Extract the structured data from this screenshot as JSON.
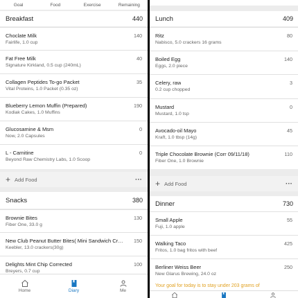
{
  "topbar": {
    "goal": "Goal",
    "food": "Food",
    "exercise": "Exercise",
    "remaining": "Remaining"
  },
  "left": {
    "breakfast": {
      "title": "Breakfast",
      "calories": "440",
      "items": [
        {
          "name": "Choclate Milk",
          "desc": "Fairlife, 1.0 cup",
          "kcal": "140"
        },
        {
          "name": "Fat Free Milk",
          "desc": "Signature Kirkland, 0.5 cup (240mL)",
          "kcal": "40"
        },
        {
          "name": "Collagen Peptides To-go Packet",
          "desc": "Vital Proteins, 1.0 Packet (0.35 oz)",
          "kcal": "35"
        },
        {
          "name": "Blueberry Lemon Muffin (Prepared)",
          "desc": "Kodiak Cakes, 1.0 Muffins",
          "kcal": "190"
        },
        {
          "name": "Glucosamine & Msm",
          "desc": "Now, 2.0 Capsules",
          "kcal": "0"
        },
        {
          "name": "L - Carnitine",
          "desc": "Beyond Raw Chemistry Labs, 1.0 Scoop",
          "kcal": "0"
        }
      ],
      "add_food": "Add Food"
    },
    "snacks": {
      "title": "Snacks",
      "calories": "380",
      "items": [
        {
          "name": "Brownie Bites",
          "desc": "Fiber One, 33.0 g",
          "kcal": "130"
        },
        {
          "name": "New Club Peanut Butter Bites( Mini Sandwich Crac...",
          "desc": "Keebler, 13.0 crackers(30g)",
          "kcal": "150"
        },
        {
          "name": "Delights Mint Chip Corrected",
          "desc": "Breyers, 0.7 cup",
          "kcal": "100"
        }
      ]
    },
    "nav": {
      "home": "Home",
      "diary": "Diary",
      "me": "Me"
    }
  },
  "right": {
    "lunch": {
      "title": "Lunch",
      "calories": "409",
      "items": [
        {
          "name": "Ritz",
          "desc": "Nabisco, 5.0 crackers  16 grams",
          "kcal": "80"
        },
        {
          "name": "Boiled Egg",
          "desc": "Eggs, 2.0 piece",
          "kcal": "140"
        },
        {
          "name": "Celery, raw",
          "desc": "0.2 cup chopped",
          "kcal": "3"
        },
        {
          "name": "Mustard",
          "desc": "Mustard, 1.0 tsp",
          "kcal": "0"
        },
        {
          "name": "Avocado-oil Mayo",
          "desc": "Kraft, 1.0 tbsp (14g)",
          "kcal": "45"
        },
        {
          "name": "Triple Chocolate Brownie (Corr 09/11/18)",
          "desc": "Fiber One, 1.0 Brownie",
          "kcal": "110"
        }
      ],
      "add_food": "Add Food"
    },
    "dinner": {
      "title": "Dinner",
      "calories": "730",
      "items": [
        {
          "name": "Small Apple",
          "desc": "Fuji, 1.0 apple",
          "kcal": "55"
        },
        {
          "name": "Walking Taco",
          "desc": "Fritos, 1.0 bag fritos with beef",
          "kcal": "425"
        },
        {
          "name": "Berliner Weiss Beer",
          "desc": "New Glarus Brewing, 24.0 oz",
          "kcal": "250"
        }
      ],
      "goal_note": "Your goal for today is to stay under 203 grams of"
    }
  },
  "colors": {
    "accent": "#1977c2",
    "goal_note": "#e0a020"
  }
}
